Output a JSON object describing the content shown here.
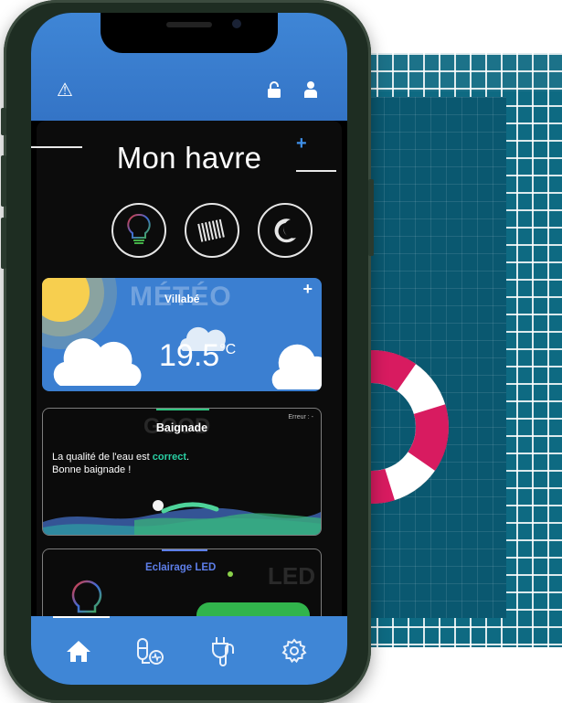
{
  "app": {
    "title": "Mon havre",
    "add_label": "+"
  },
  "icons": {
    "warning": "warning-icon",
    "lock": "lock-icon",
    "user": "user-icon",
    "quick_actions": [
      "lightbulb-icon",
      "shutter-icon",
      "moon-icon"
    ]
  },
  "weather": {
    "background_word": "MÉTÉO",
    "city": "Villabé",
    "temperature": "19.5",
    "unit": "°C",
    "add_label": "+"
  },
  "bathing": {
    "background_word": "GOOD",
    "title": "Baignade",
    "error_text": "Erreur : -",
    "message_prefix": "La qualité de l'eau est ",
    "quality": "correct",
    "message_suffix": ".",
    "message_line2": "Bonne baignade !"
  },
  "led": {
    "title": "Eclairage LED",
    "background_word": "LED"
  },
  "nav": {
    "items": [
      "home-icon",
      "pool-equipment-icon",
      "plug-icon",
      "settings-icon"
    ],
    "active_index": 0
  },
  "colors": {
    "accent_blue": "#3f86d6",
    "pool": "#0e6a82",
    "buoy_red": "#d81b60",
    "quality_green": "#29d0a4",
    "led_blue": "#5d7ee8",
    "toggle_green": "#31b44c"
  }
}
